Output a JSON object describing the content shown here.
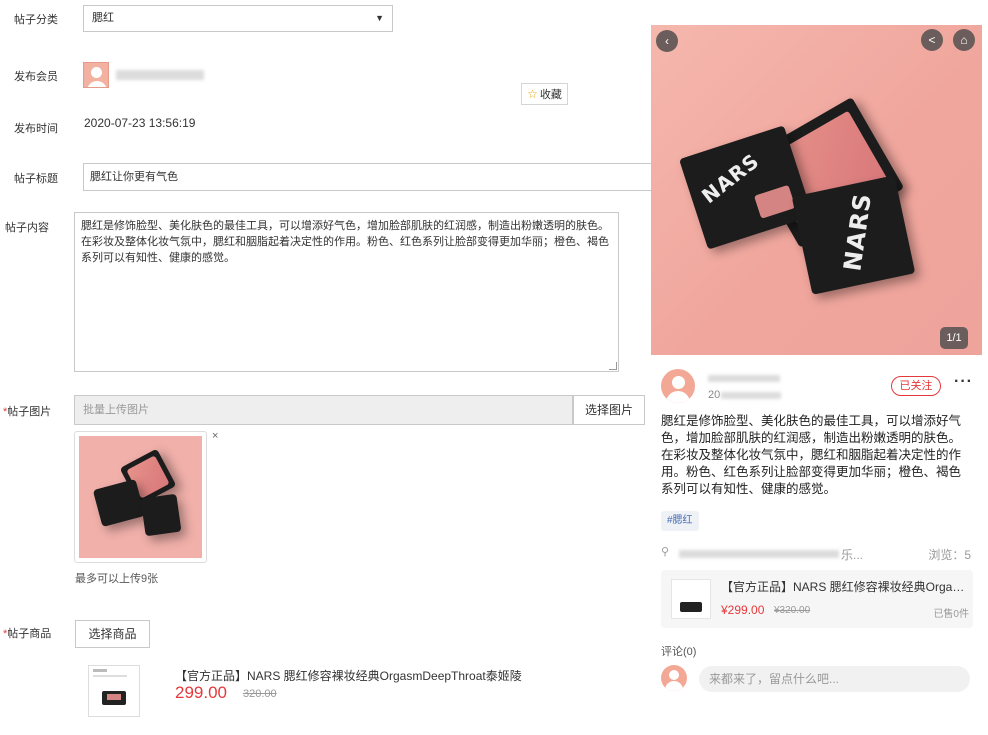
{
  "form": {
    "category": {
      "label": "帖子分类",
      "value": "腮红"
    },
    "member": {
      "label": "发布会员",
      "favorite_label": "收藏"
    },
    "time": {
      "label": "发布时间",
      "value": "2020-07-23 13:56:19"
    },
    "title": {
      "label": "帖子标题",
      "value": "腮红让你更有气色"
    },
    "content": {
      "label": "帖子内容",
      "value": "腮红是修饰脸型、美化肤色的最佳工具，可以增添好气色，增加脸部肌肤的红润感，制造出粉嫩透明的肤色。在彩妆及整体化妆气氛中，腮红和胭脂起着决定性的作用。粉色、红色系列让脸部变得更加华丽；橙色、褐色系列可以有知性、健康的感觉。"
    },
    "images": {
      "label": "帖子图片",
      "upload_placeholder": "批量上传图片",
      "pick_button": "选择图片",
      "remove_symbol": "×",
      "hint": "最多可以上传9张"
    },
    "goods": {
      "label": "帖子商品",
      "pick_button": "选择商品",
      "title": "【官方正品】NARS 腮红修容裸妆经典OrgasmDeepThroat泰姬陵",
      "price": "299.00",
      "original_price": "320.00"
    }
  },
  "preview": {
    "image_counter": "1/1",
    "user_date_prefix": "20",
    "follow_label": "已关注",
    "more_symbol": "···",
    "content": "腮红是修饰脸型、美化肤色的最佳工具，可以增添好气色，增加脸部肌肤的红润感，制造出粉嫩透明的肤色。在彩妆及整体化妆气氛中，腮红和胭脂起着决定性的作用。粉色、红色系列让脸部变得更加华丽；橙色、褐色系列可以有知性、健康的感觉。",
    "tag": "#腮红",
    "location_suffix": "乐...",
    "views": "浏览：5",
    "goods": {
      "title": "【官方正品】NARS 腮红修容裸妆经典Orgas...",
      "price": "¥299.00",
      "original_price": "¥320.00",
      "sold": "已售0件"
    },
    "comment_count": "评论(0)",
    "comment_placeholder": "来都来了，留点什么吧..."
  },
  "colors": {
    "accent_red": "#e4393c",
    "product_pink": "#f0a69d",
    "tag_blue": "#4a6cb3"
  },
  "icons": [
    "back-icon",
    "share-icon",
    "home-icon",
    "star-icon",
    "location-icon",
    "user-avatar-icon"
  ]
}
